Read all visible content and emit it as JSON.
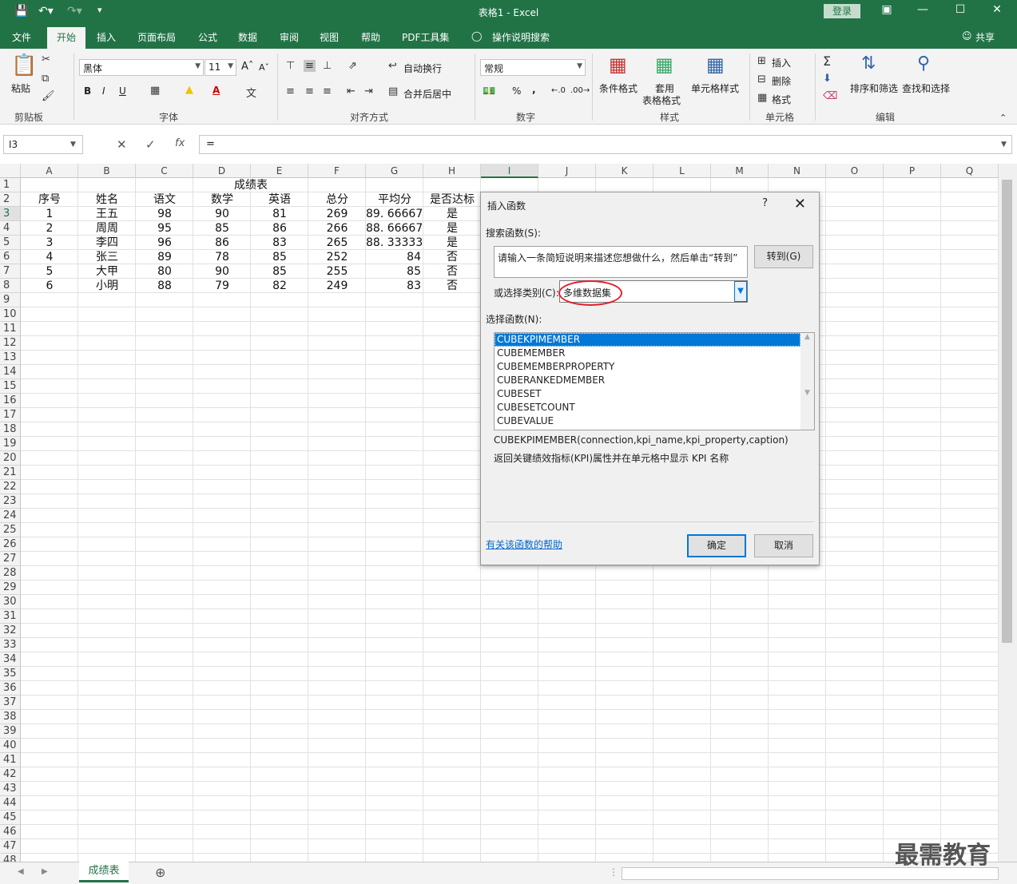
{
  "window": {
    "title": "表格1  -  Excel",
    "login_label": "登录"
  },
  "ribbon_tabs": [
    "文件",
    "开始",
    "插入",
    "页面布局",
    "公式",
    "数据",
    "审阅",
    "视图",
    "帮助",
    "PDF工具集",
    "操作说明搜索"
  ],
  "share_label": "共享",
  "clipboard": {
    "paste": "粘贴",
    "group": "剪贴板"
  },
  "font": {
    "name": "黑体",
    "size": "11",
    "group": "字体",
    "bold": "B",
    "italic": "I",
    "underline": "U"
  },
  "alignment": {
    "wrap": "自动换行",
    "merge": "合并后居中",
    "group": "对齐方式"
  },
  "number": {
    "format": "常规",
    "group": "数字",
    "percent": "%",
    "comma": ","
  },
  "styles": {
    "conditional": "条件格式",
    "table1": "套用",
    "table2": "表格格式",
    "cell_styles": "单元格样式",
    "group": "样式"
  },
  "cells": {
    "insert": "插入",
    "delete": "删除",
    "format": "格式",
    "group": "单元格"
  },
  "editing": {
    "sort": "排序和筛选",
    "find": "查找和选择",
    "group": "编辑"
  },
  "formula_bar": {
    "name_box": "I3",
    "formula": "="
  },
  "columns": [
    "A",
    "B",
    "C",
    "D",
    "E",
    "F",
    "G",
    "H",
    "I",
    "J",
    "K",
    "L",
    "M",
    "N",
    "O",
    "P",
    "Q"
  ],
  "sheet": {
    "title": "成绩表",
    "headers": [
      "序号",
      "姓名",
      "语文",
      "数学",
      "英语",
      "总分",
      "平均分",
      "是否达标"
    ],
    "rows": [
      [
        "1",
        "王五",
        "98",
        "90",
        "81",
        "269",
        "89. 66667",
        "是"
      ],
      [
        "2",
        "周周",
        "95",
        "85",
        "86",
        "266",
        "88. 66667",
        "是"
      ],
      [
        "3",
        "李四",
        "96",
        "86",
        "83",
        "265",
        "88. 33333",
        "是"
      ],
      [
        "4",
        "张三",
        "89",
        "78",
        "85",
        "252",
        "84",
        "否"
      ],
      [
        "5",
        "大甲",
        "80",
        "90",
        "85",
        "255",
        "85",
        "否"
      ],
      [
        "6",
        "小明",
        "88",
        "79",
        "82",
        "249",
        "83",
        "否"
      ]
    ],
    "tab_name": "成绩表"
  },
  "dialog": {
    "title": "插入函数",
    "help": "?",
    "search_label": "搜索函数(S):",
    "search_text": "请输入一条简短说明来描述您想做什么，然后单击“转到”",
    "go_button": "转到(G)",
    "category_label": "或选择类别(C):",
    "category_value": "多维数据集",
    "select_label": "选择函数(N):",
    "functions": [
      "CUBEKPIMEMBER",
      "CUBEMEMBER",
      "CUBEMEMBERPROPERTY",
      "CUBERANKEDMEMBER",
      "CUBESET",
      "CUBESETCOUNT",
      "CUBEVALUE"
    ],
    "signature": "CUBEKPIMEMBER(connection,kpi_name,kpi_property,caption)",
    "description": "返回关键绩效指标(KPI)属性并在单元格中显示 KPI 名称",
    "help_link": "有关该函数的帮助",
    "ok": "确定",
    "cancel": "取消"
  },
  "watermark": "最需教育"
}
